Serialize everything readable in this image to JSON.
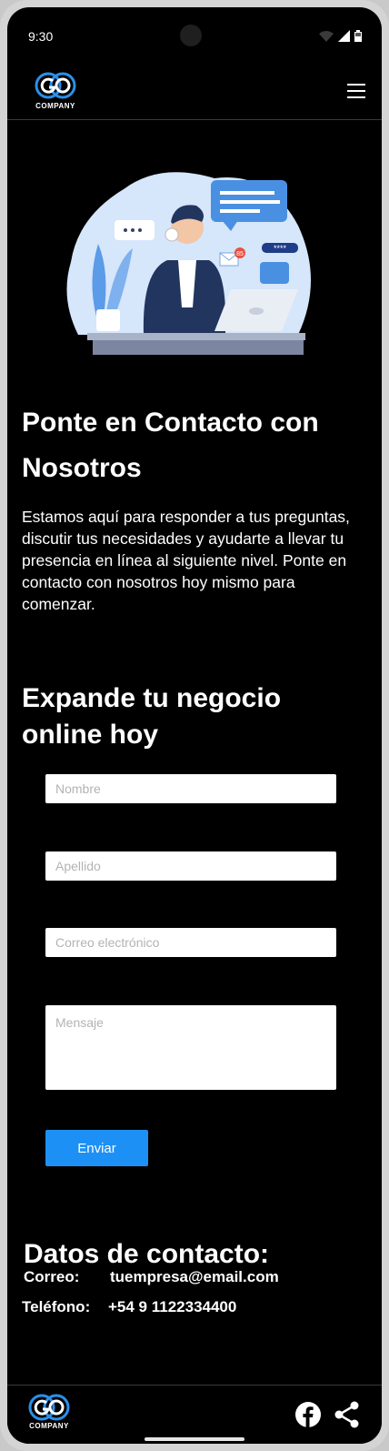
{
  "status_bar": {
    "time": "9:30"
  },
  "header": {
    "logo_letters": "GO",
    "logo_text": "COMPANY"
  },
  "hero": {
    "title": "Ponte en Contacto con Nosotros",
    "intro": "Estamos aquí para responder a tus preguntas, discutir tus necesidades y ayudarte a llevar tu presencia en línea al siguiente nivel. Ponte en contacto con nosotros hoy mismo para comenzar.",
    "illustration_badge": "85",
    "illustration_password": "****",
    "colors": {
      "background_blob": "#d6e6fb",
      "accent": "#4a90e2"
    }
  },
  "form": {
    "title": "Expande tu negocio online hoy",
    "first_name_placeholder": "Nombre",
    "last_name_placeholder": "Apellido",
    "email_placeholder": "Correo electrónico",
    "message_placeholder": "Mensaje",
    "submit_label": "Enviar",
    "submit_color": "#1d90f5"
  },
  "contact": {
    "title": "Datos de contacto:",
    "email_label": "Correo:",
    "email_value": "tuempresa@email.com",
    "phone_label": "Teléfono:",
    "phone_value": "+54 9 1122334400"
  },
  "footer": {
    "logo_letters": "GO",
    "logo_text": "COMPANY",
    "icons": [
      "facebook-icon",
      "share-icon"
    ]
  }
}
